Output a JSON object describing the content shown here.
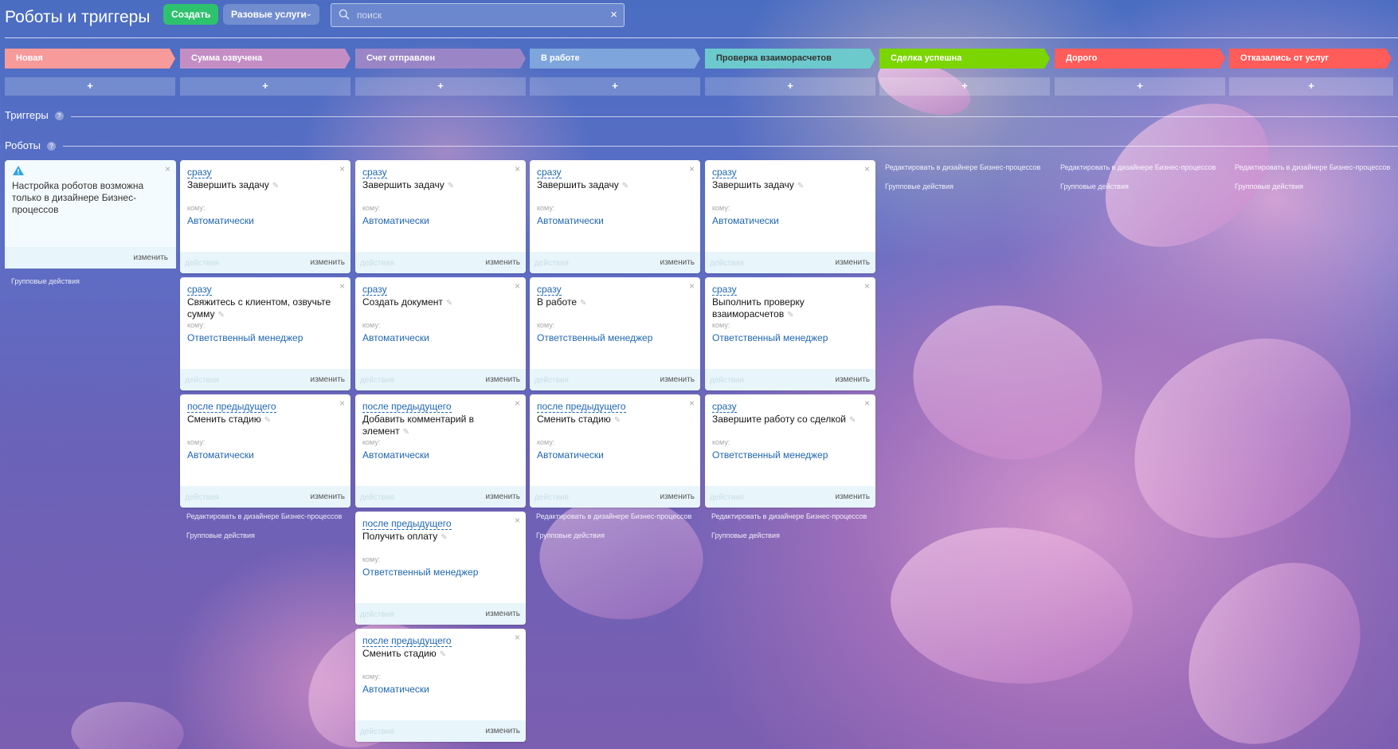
{
  "header": {
    "title": "Роботы и триггеры",
    "create_label": "Создать",
    "category_label": "Разовые услуги",
    "search_placeholder": "поиск"
  },
  "stages": [
    {
      "name": "Новая",
      "color": "#f79a9a"
    },
    {
      "name": "Сумма озвучена",
      "color": "#c48ec5"
    },
    {
      "name": "Счет отправлен",
      "color": "#9a86c6"
    },
    {
      "name": "В работе",
      "color": "#7ea5dc"
    },
    {
      "name": "Проверка взаиморасчетов",
      "color": "#6ccacd"
    },
    {
      "name": "Сделка успешна",
      "color": "#7bd500"
    },
    {
      "name": "Дорого",
      "color": "#ff5c5a"
    },
    {
      "name": "Отказались от услуг",
      "color": "#ff5c5a"
    }
  ],
  "add_label": "+",
  "sections": {
    "triggers": "Триггеры",
    "robots": "Роботы",
    "help": "?"
  },
  "warning": {
    "text": "Настройка роботов возможна только в дизайнере Бизнес-процессов",
    "edit": "изменить"
  },
  "labels": {
    "whom": "кому:",
    "actions": "действия",
    "edit": "изменить",
    "designer": "Редактировать в дизайнере Бизнес-процессов",
    "group": "Групповые действия"
  },
  "columns": [
    {
      "cards": [
        {
          "cond": "сразу",
          "title": "Завершить задачу",
          "whom": "Автоматически"
        },
        {
          "cond": "сразу",
          "title": "Свяжитесь с клиентом, озвучьте сумму",
          "whom": "Ответственный менеджер"
        },
        {
          "cond": "после предыдущего",
          "title": "Сменить стадию",
          "whom": "Автоматически"
        }
      ]
    },
    {
      "cards": [
        {
          "cond": "сразу",
          "title": "Завершить задачу",
          "whom": "Автоматически"
        },
        {
          "cond": "сразу",
          "title": "Создать документ",
          "whom": "Автоматически"
        },
        {
          "cond": "после предыдущего",
          "title": "Добавить комментарий в элемент",
          "whom": "Автоматически"
        },
        {
          "cond": "после предыдущего",
          "title": "Получить оплату",
          "whom": "Ответственный менеджер"
        },
        {
          "cond": "после предыдущего",
          "title": "Сменить стадию",
          "whom": "Автоматически"
        }
      ]
    },
    {
      "cards": [
        {
          "cond": "сразу",
          "title": "Завершить задачу",
          "whom": "Автоматически"
        },
        {
          "cond": "сразу",
          "title": "В работе",
          "whom": "Ответственный менеджер"
        },
        {
          "cond": "после предыдущего",
          "title": "Сменить стадию",
          "whom": "Автоматически"
        }
      ]
    },
    {
      "cards": [
        {
          "cond": "сразу",
          "title": "Завершить задачу",
          "whom": "Автоматически"
        },
        {
          "cond": "сразу",
          "title": "Выполнить проверку взаиморасчетов",
          "whom": "Ответственный менеджер"
        },
        {
          "cond": "сразу",
          "title": "Завершите работу со сделкой",
          "whom": "Ответственный менеджер"
        }
      ]
    }
  ],
  "colors": {
    "link": "#2067b0",
    "card_footer": "#e8f5fb",
    "create_button": "#2fc26e"
  }
}
